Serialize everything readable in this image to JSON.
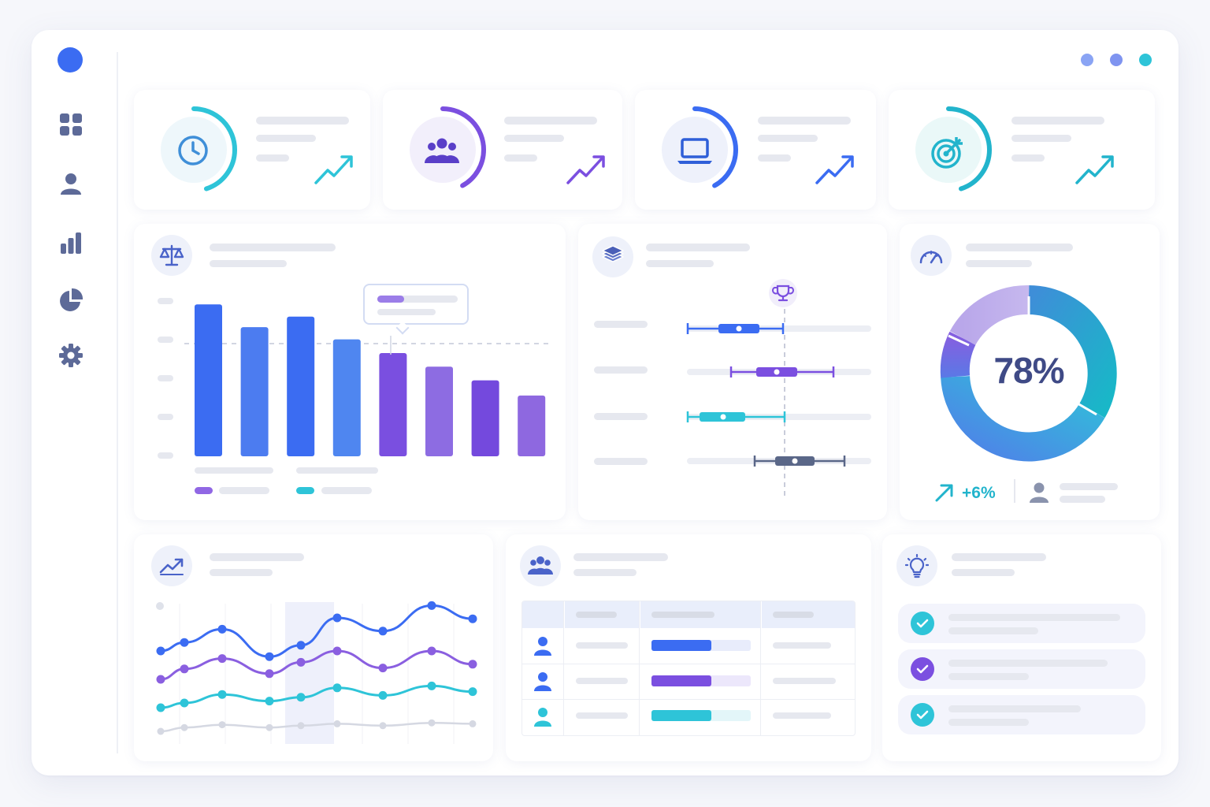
{
  "gauge": {
    "percent_label": "78%",
    "value": 0.78,
    "delta_label": "+6%"
  },
  "kpi_cards": [
    {
      "icon": "clock-icon",
      "accent": "#2ec4d8",
      "progress": 0.45
    },
    {
      "icon": "users-icon",
      "accent": "#7b4fe0",
      "progress": 0.42
    },
    {
      "icon": "laptop-icon",
      "accent": "#3b6cf2",
      "progress": 0.42
    },
    {
      "icon": "target-icon",
      "accent": "#22b4cc",
      "progress": 0.45
    }
  ],
  "colors": {
    "blue": "#3b6cf2",
    "purple": "#7b4fe0",
    "cyan": "#2ec4d8",
    "gray": "#c9cdd9"
  },
  "nav_items": [
    "grid-icon",
    "user-icon",
    "bar-chart-icon",
    "pie-chart-icon",
    "settings-icon"
  ],
  "chart_data": [
    {
      "type": "bar",
      "categories": [
        "",
        "",
        "",
        "",
        "",
        "",
        "",
        ""
      ],
      "values": [
        100,
        85,
        92,
        77,
        68,
        59,
        50,
        40
      ],
      "ylim": [
        0,
        110
      ]
    },
    {
      "type": "line",
      "series": [
        {
          "values": [
            45,
            54,
            68,
            39,
            51,
            80,
            66,
            93,
            79
          ]
        },
        {
          "values": [
            15,
            26,
            37,
            21,
            33,
            45,
            27,
            45,
            31
          ]
        },
        {
          "values": [
            -15,
            -10,
            -1,
            -8,
            -4,
            6,
            -2,
            8,
            2
          ]
        },
        {
          "values": [
            -40,
            -36,
            -33,
            -36,
            -34,
            -32,
            -34,
            -31,
            -32
          ]
        }
      ]
    }
  ],
  "table": {
    "rows": [
      {
        "avatar": "user-icon",
        "bar_color": "#3b6cf2",
        "bar_fill": 0.6
      },
      {
        "avatar": "user-icon",
        "bar_color": "#7b4fe0",
        "bar_fill": 0.6
      },
      {
        "avatar": "user-icon",
        "bar_color": "#2ec4d8",
        "bar_fill": 0.6
      }
    ]
  },
  "tasks": [
    {
      "check_color": "#2ec4d8",
      "done": true
    },
    {
      "check_color": "#7b4fe0",
      "done": true
    },
    {
      "check_color": "#2ec4d8",
      "done": true
    }
  ]
}
